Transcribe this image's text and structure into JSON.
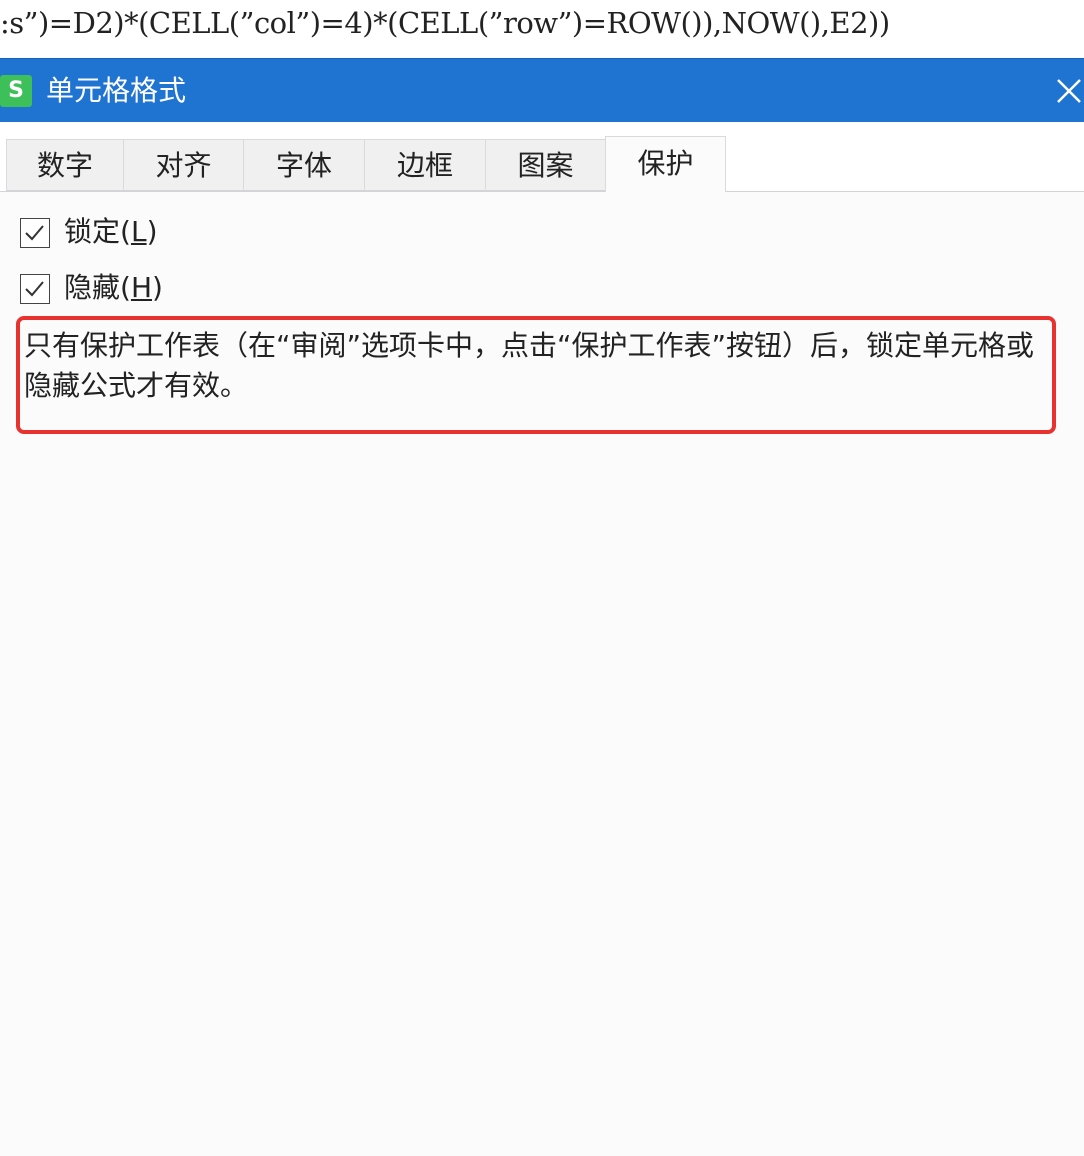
{
  "formula_bar": {
    "text": "s”)=D2)*(CELL(”col”)=4)*(CELL(”row”)=ROW()),NOW(),E2))",
    "prefix": ":"
  },
  "dialog": {
    "app_icon_letter": "S",
    "title": "单元格格式",
    "close_symbol": "×"
  },
  "tabs": [
    {
      "label": "数字"
    },
    {
      "label": "对齐"
    },
    {
      "label": "字体"
    },
    {
      "label": "边框"
    },
    {
      "label": "图案"
    },
    {
      "label": "保护"
    }
  ],
  "active_tab": "保护",
  "protection": {
    "locked": {
      "label": "锁定",
      "shortcut": "L",
      "checked": true
    },
    "hidden": {
      "label": "隐藏",
      "shortcut": "H",
      "checked": true
    },
    "note": "只有保护工作表（在“审阅”选项卡中，点击“保护工作表”按钮）后，锁定单元格或隐藏公式才有效。"
  },
  "colors": {
    "titlebar": "#1f73d1",
    "app_icon": "#3dbf5a",
    "highlight_border": "#e8322f"
  }
}
